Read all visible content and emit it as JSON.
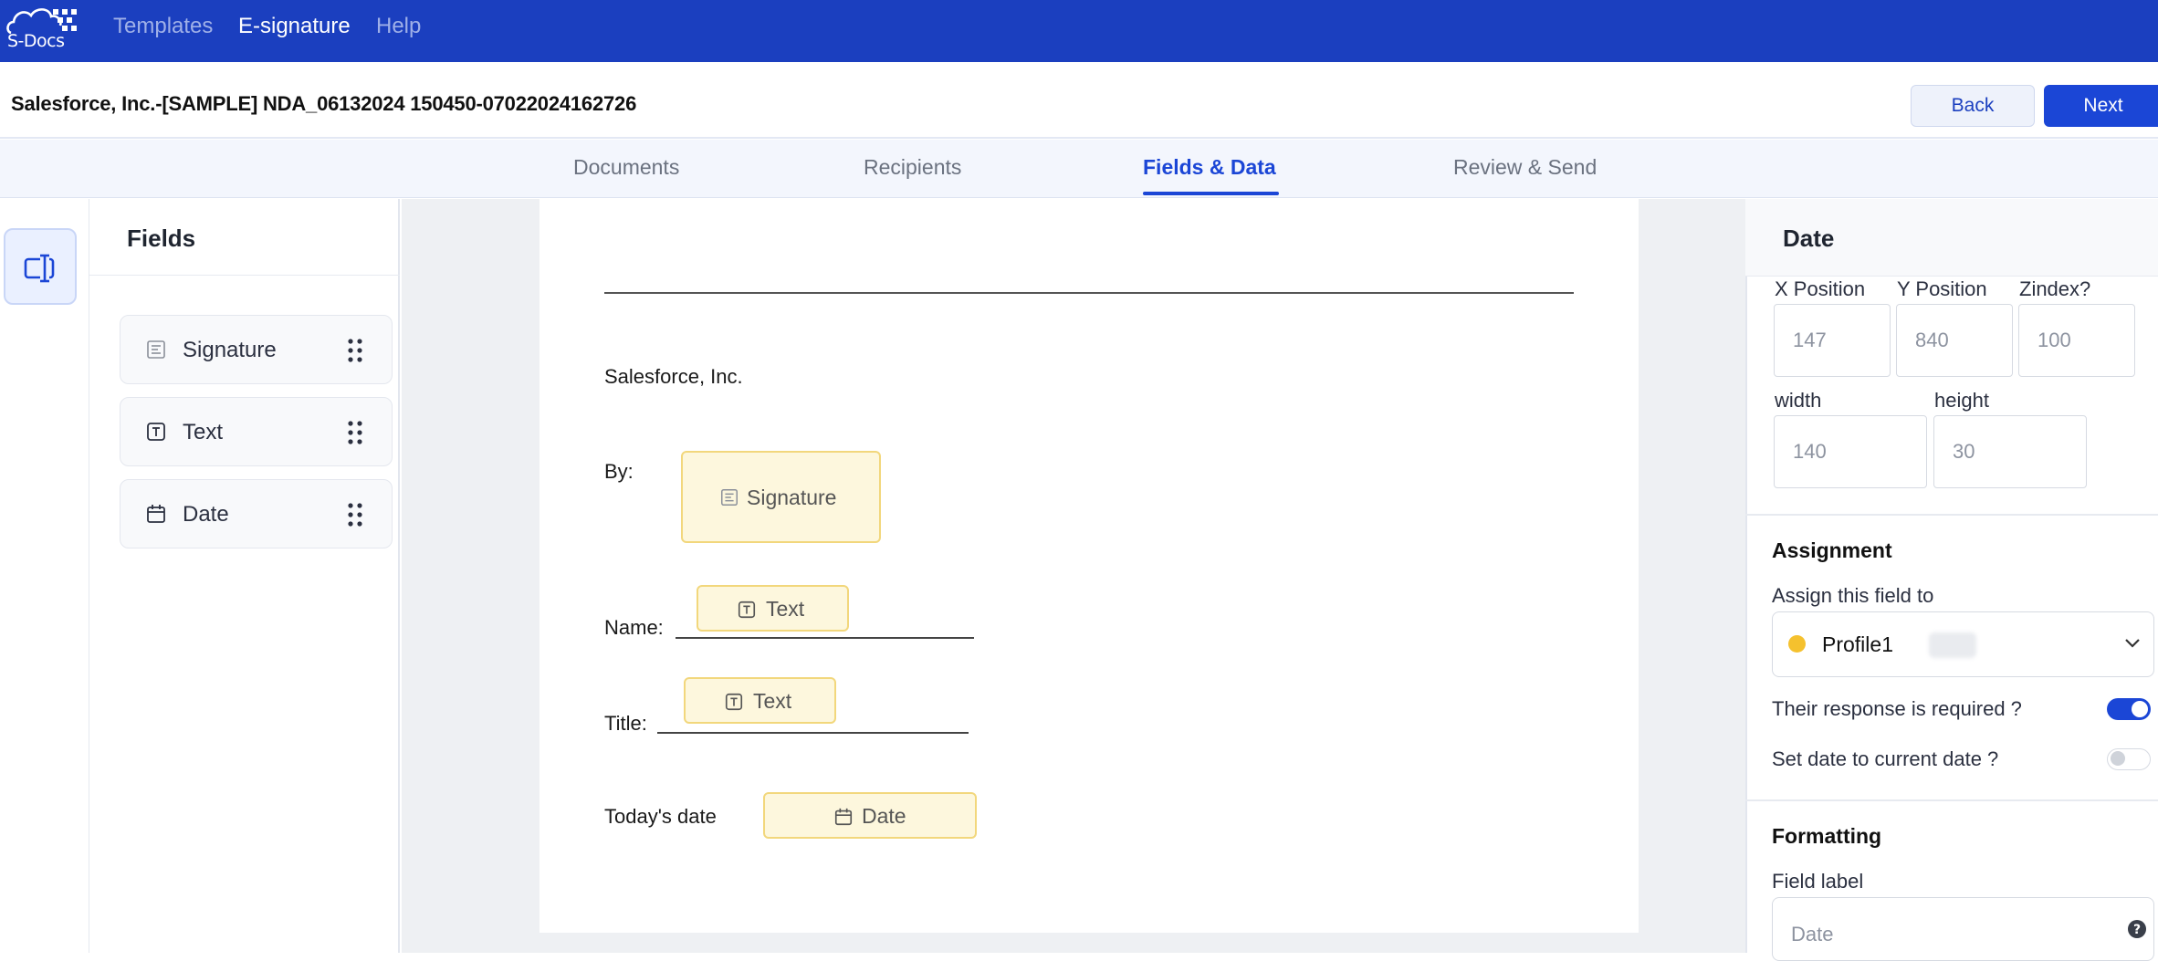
{
  "colors": {
    "topbar": "#1b3fbf",
    "accent": "#1b46d6",
    "field_fill": "#fdf7dd",
    "field_border": "#f2d77c",
    "recipient_dot": "#f5c12e"
  },
  "app": {
    "logo_text": "S-Docs",
    "nav": [
      "Templates",
      "E-signature",
      "Help"
    ],
    "nav_active": "E-signature"
  },
  "header": {
    "document_title": "Salesforce, Inc.-[SAMPLE] NDA_06132024 150450-07022024162726",
    "back_label": "Back",
    "next_label": "Next"
  },
  "steps": {
    "items": [
      "Documents",
      "Recipients",
      "Fields & Data",
      "Review & Send"
    ],
    "active": "Fields & Data"
  },
  "rail": {
    "icon": "text-field-icon"
  },
  "fields_panel": {
    "title": "Fields",
    "items": [
      {
        "label": "Signature",
        "icon": "signature-icon"
      },
      {
        "label": "Text",
        "icon": "text-icon"
      },
      {
        "label": "Date",
        "icon": "calendar-icon"
      }
    ]
  },
  "document": {
    "company": "Salesforce, Inc.",
    "by_label": "By:",
    "name_label": "Name:",
    "title_label": "Title:",
    "date_label": "Today's date",
    "signature_field": "Signature",
    "name_field": "Text",
    "title_field": "Text",
    "date_field": "Date"
  },
  "properties": {
    "title": "Date",
    "x_label": "X Position",
    "x_value": "147",
    "y_label": "Y Position",
    "y_value": "840",
    "z_label": "Zindex?",
    "z_value": "100",
    "width_label": "width",
    "width_value": "140",
    "height_label": "height",
    "height_value": "30",
    "assignment_title": "Assignment",
    "assign_label": "Assign this field to",
    "assignee": "Profile1",
    "required_label": "Their response is required ?",
    "required_on": true,
    "current_date_label": "Set date to current date ?",
    "current_date_on": false,
    "formatting_title": "Formatting",
    "field_label_title": "Field label",
    "field_label_placeholder": "Date"
  }
}
